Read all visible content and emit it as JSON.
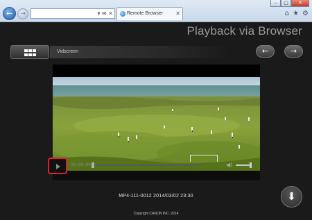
{
  "browser": {
    "window_controls": {
      "minimize": "–",
      "maximize": "□",
      "close": "✕"
    },
    "back_icon": "←",
    "forward_icon": "→",
    "address": {
      "value": "",
      "tools": "▾ ✉ ✕"
    },
    "tab": {
      "title": "Remote Browser",
      "close": "✕"
    },
    "toolbar_icons": {
      "home": "⌂",
      "favorites": "★",
      "settings": "⚙"
    }
  },
  "app": {
    "title": "Playback via Browser",
    "current_file_label": "Vidscreen",
    "prev_icon": "←",
    "next_icon": "→"
  },
  "player": {
    "timecode": "00:00:00",
    "progress": 0.0,
    "volume_icon": "◀)",
    "volume_level": 0.85
  },
  "file_info": "MP4-111-0012 2014/03/02 23:30",
  "copyright": "Copyright CANON INC. 2014",
  "download_icon": "⬇",
  "colors": {
    "highlight_box": "#e0202a",
    "background": "#1a1a1a"
  }
}
